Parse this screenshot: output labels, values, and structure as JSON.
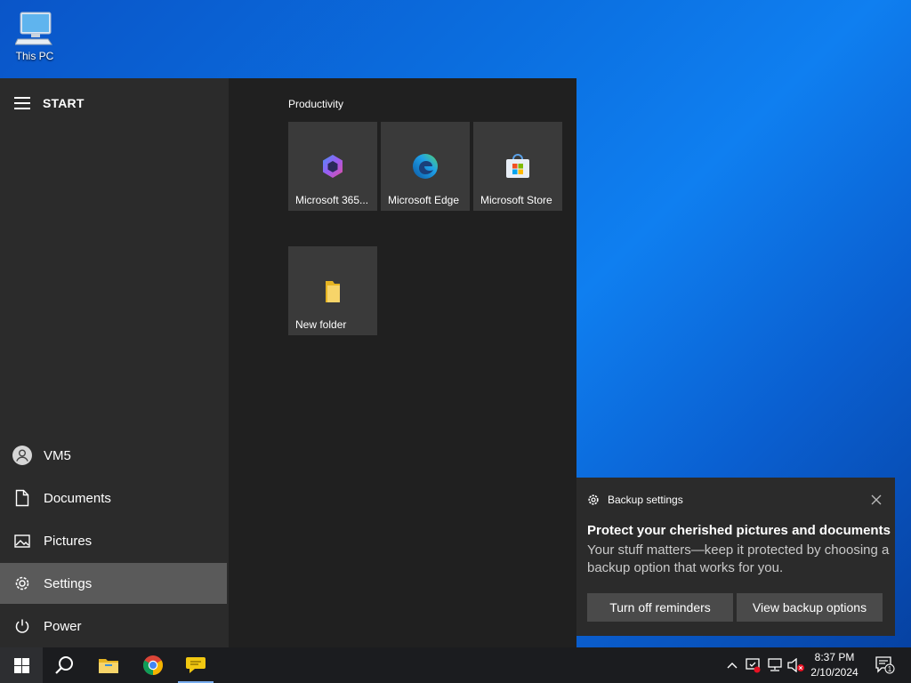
{
  "desktop": {
    "icons": [
      {
        "label": "This PC",
        "icon": "computer-icon"
      }
    ]
  },
  "start": {
    "title": "START",
    "rail": [
      {
        "label": "VM5",
        "icon": "user-avatar-icon"
      },
      {
        "label": "Documents",
        "icon": "document-icon"
      },
      {
        "label": "Pictures",
        "icon": "pictures-icon"
      },
      {
        "label": "Settings",
        "icon": "gear-icon",
        "selected": true
      },
      {
        "label": "Power",
        "icon": "power-icon"
      }
    ],
    "group_title": "Productivity",
    "tiles": [
      {
        "label": "Microsoft 365...",
        "icon": "microsoft-365-icon"
      },
      {
        "label": "Microsoft Edge",
        "icon": "edge-icon"
      },
      {
        "label": "Microsoft Store",
        "icon": "store-icon"
      },
      {
        "label": "New folder",
        "icon": "folder-icon"
      }
    ]
  },
  "toast": {
    "source": "Backup settings",
    "title": "Protect your cherished pictures and documents",
    "body": "Your stuff matters—keep it protected by choosing a backup option that works for you.",
    "buttons": [
      "Turn off reminders",
      "View backup options"
    ]
  },
  "taskbar": {
    "apps": [
      "start-icon",
      "search-icon",
      "file-explorer-icon",
      "chrome-icon",
      "feedback-icon"
    ],
    "tray_icons": [
      "chevron-up-icon",
      "security-alert-icon",
      "network-icon",
      "volume-muted-icon"
    ],
    "time": "8:37 PM",
    "date": "2/10/2024",
    "notification_count": "1"
  },
  "colors": {
    "accent": "#0078d4",
    "start_rail": "#2b2b2b",
    "start_tiles": "#202020",
    "tile": "#3a3a3a",
    "taskbar": "#1b1c1f"
  }
}
